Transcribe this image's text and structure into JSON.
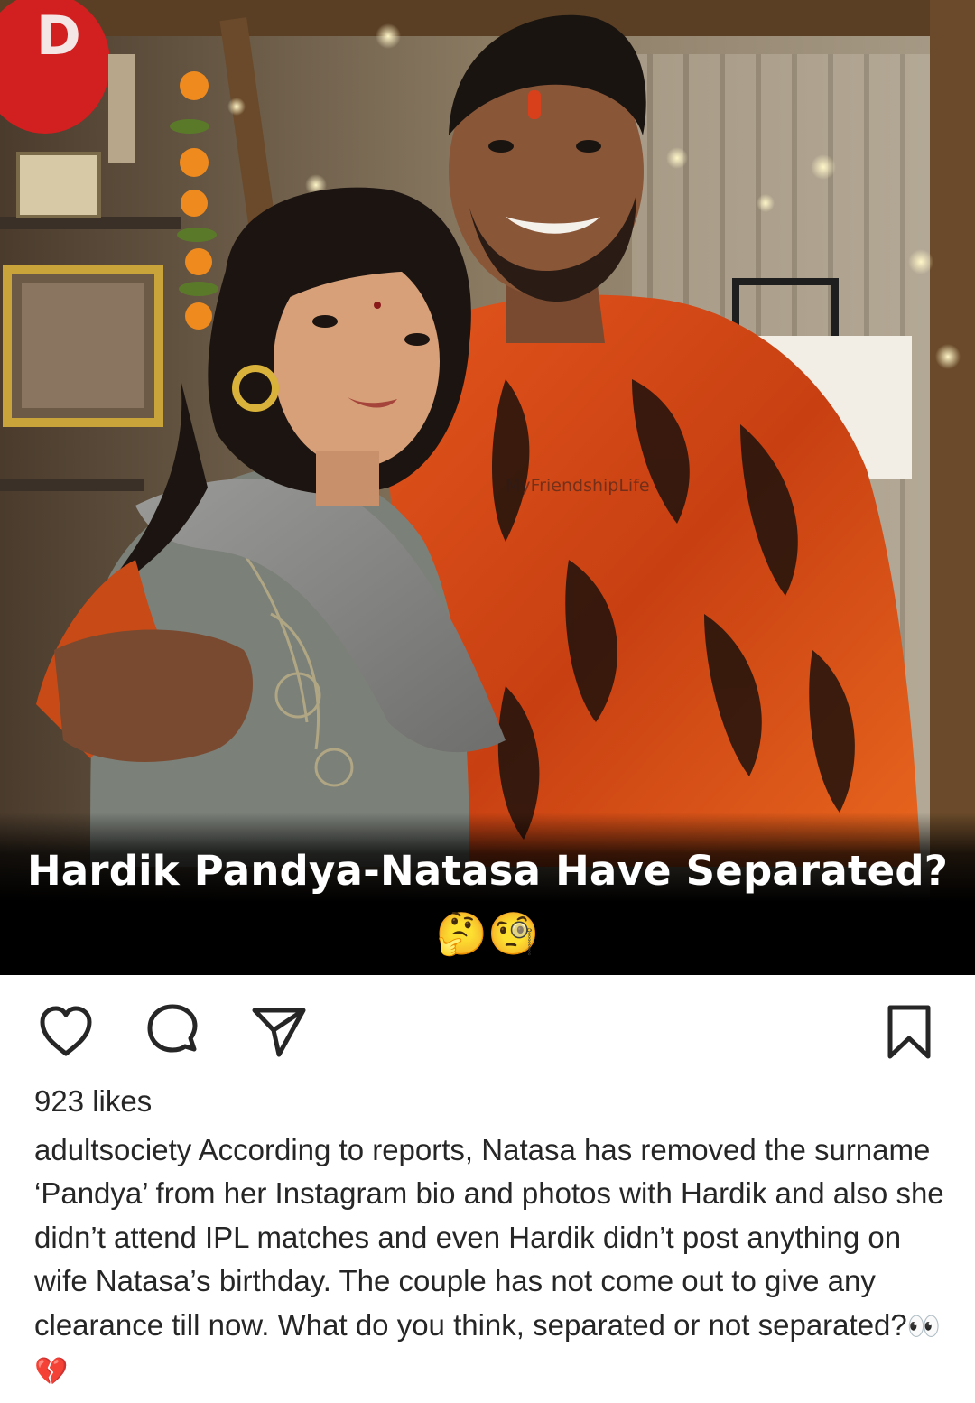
{
  "post": {
    "image_alt": "Couple posing together in front of a decorated shelf with string lights",
    "headline": "Hardik Pandya-Natasa Have Separated?",
    "headline_emojis": "🤔🧐",
    "watermark": "MyFriendshipLife"
  },
  "actions": {
    "like_icon": "heart-outline-icon",
    "comment_icon": "speech-bubble-icon",
    "share_icon": "paper-plane-icon",
    "save_icon": "bookmark-icon"
  },
  "likes": {
    "label": "923 likes"
  },
  "caption": {
    "username": "adultsociety",
    "text": " According to reports, Natasa has removed the surname ‘Pandya’ from her Instagram bio and photos with Hardik and also she didn’t attend IPL matches and even Hardik didn’t post anything on wife Natasa’s birthday. The couple has not come out to give any clearance till now. What do you think, separated or not separated?",
    "emojis": "👀💔"
  },
  "colors": {
    "text": "#262626",
    "icon": "#262626",
    "headline_text": "#ffffff",
    "headline_band": "#000000"
  }
}
